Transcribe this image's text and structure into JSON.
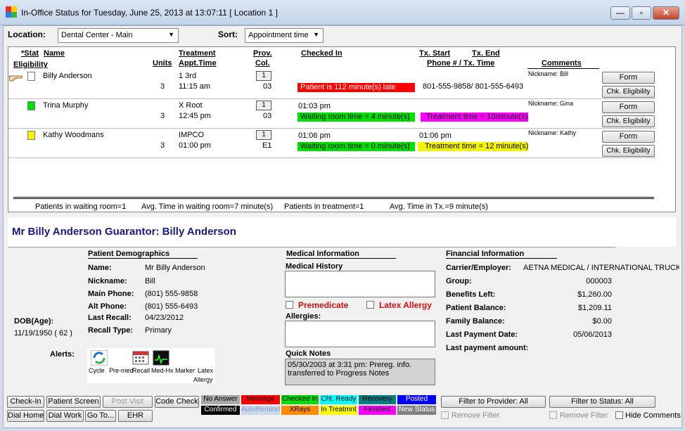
{
  "window": {
    "title": "In-Office Status for Tuesday, June 25, 2013 at 13:07:11 [ Location 1 ]",
    "min": "—",
    "max": "▫",
    "close": "✕"
  },
  "filters": {
    "location_label": "Location:",
    "location_value": "Dental Center - Main",
    "sort_label": "Sort:",
    "sort_value": "Appointment time"
  },
  "columns": {
    "stat": "*Stat",
    "name": "Name",
    "eligibility": "Eligibility",
    "units": "Units",
    "treatment": "Treatment",
    "appt_time": "Appt.Time",
    "prov": "Prov.",
    "col": "Col.",
    "checked_in": "Checked In",
    "tx_start": "Tx. Start",
    "tx_end": "Tx. End",
    "phone_tx_time": "Phone # / Tx. Time",
    "comments": "Comments"
  },
  "patients": [
    {
      "name": "Billy Anderson",
      "units": "3",
      "treatment": "1 3rd",
      "appt_time": "11:15 am",
      "col": "1",
      "prov": "03",
      "checked_in": "",
      "status_msg": "Patient is 112 minute(s) late",
      "tx_start": "",
      "phone": "801-555-9858/ 801-555-6493",
      "treatment_msg": "",
      "comment": "Nickname: Bill",
      "form": "Form",
      "chk": "Chk. Eligibility",
      "status_color": "#ffffff"
    },
    {
      "name": "Trina Murphy",
      "units": "3",
      "treatment": "X Root",
      "appt_time": "12:45 pm",
      "col": "1",
      "prov": "03",
      "checked_in": "01:03 pm",
      "status_msg": "Waiting room time = 4 minute(s)",
      "tx_start": "",
      "phone": "",
      "treatment_msg": "Treatment time = 10minute(s)",
      "comment": "Nickname: Gina",
      "form": "Form",
      "chk": "Chk. Eligibility",
      "status_color": "#00e000"
    },
    {
      "name": "Kathy Woodmans",
      "units": "3",
      "treatment": "IMPCO",
      "appt_time": "01:00 pm",
      "col": "1",
      "prov": "E1",
      "checked_in": "01:06 pm",
      "status_msg": "Waiting room time = 0 minute(s)",
      "tx_start": "01:06 pm",
      "phone": "",
      "treatment_msg": "Treatment time = 12 minute(s)",
      "comment": "Nickname: Kathy",
      "form": "Form",
      "chk": "Chk. Eligibility",
      "status_color": "#f5f500"
    }
  ],
  "summary": {
    "waiting": "Patients in waiting room=1",
    "avg_waiting": "Avg. Time in waiting room=7 minute(s)",
    "in_treatment": "Patients in treatment=1",
    "avg_tx": "Avg. Time in Tx.=9 minute(s)"
  },
  "detail": {
    "header": "Mr Billy Anderson  Guarantor: Billy Anderson",
    "dob_label": "DOB(Age):",
    "dob_value": "11/19/1950 ( 62 )",
    "alerts_label": "Alerts:",
    "alert_icons": [
      "Cycle",
      "Pre-med",
      "Recall",
      "Med-Hx",
      "Marker",
      "Latex",
      "Allergy"
    ],
    "demographics": {
      "title": "Patient Demographics",
      "name_label": "Name:",
      "name": "Mr Billy Anderson",
      "nickname_label": "Nickname:",
      "nickname": "Bill",
      "main_phone_label": "Main Phone:",
      "main_phone": "(801) 555-9858",
      "alt_phone_label": "Alt Phone:",
      "alt_phone": "(801) 555-6493",
      "last_recall_label": "Last Recall:",
      "last_recall": "04/23/2012",
      "recall_type_label": "Recall Type:",
      "recall_type": "Primary"
    },
    "medical": {
      "title": "Medical Information",
      "history_label": "Medical History",
      "premedicate": "Premedicate",
      "latex": "Latex Allergy",
      "allergies_label": "Allergies:",
      "quick_notes_label": "Quick Notes",
      "quick_notes": "05/30/2003 at 3:31 pm: Prereg. info. transferred to Progress Notes"
    },
    "financial": {
      "title": "Financial Information",
      "carrier_label": "Carrier/Employer:",
      "carrier": "AETNA MEDICAL / INTERNATIONAL TRUCK",
      "group_label": "Group:",
      "group": "000003",
      "benefits_label": "Benefits Left:",
      "benefits": "$1,260.00",
      "patient_balance_label": "Patient Balance:",
      "patient_balance": "$1,209.11",
      "family_balance_label": "Family Balance:",
      "family_balance": "$0.00",
      "last_payment_date_label": "Last Payment Date:",
      "last_payment_date": "05/06/2013",
      "last_payment_amount_label": "Last payment amount:",
      "last_payment_amount": ""
    }
  },
  "buttons": {
    "check_in": "Check-In",
    "patient_screen": "Patient Screen",
    "post_visit": "Post Visit",
    "code_check": "Code Check",
    "dial_home": "Dial Home",
    "dial_work": "Dial Work",
    "go_to": "Go To...",
    "ehr": "EHR",
    "filter_provider": "Filter to Provider: All",
    "filter_status": "Filter to Status: All",
    "remove_filter_1": "Remove Filter",
    "remove_filter_2": "Remove Filter",
    "hide_comments": "Hide Comments"
  },
  "legend": [
    {
      "label": "No Answer",
      "bg": "#a8a8a8",
      "fg": "#000000"
    },
    {
      "label": "Message",
      "bg": "#ff0000",
      "fg": "#000000"
    },
    {
      "label": "Checked In",
      "bg": "#00dd00",
      "fg": "#000000"
    },
    {
      "label": "Cht. Ready",
      "bg": "#00ffff",
      "fg": "#000000"
    },
    {
      "label": "Recovery",
      "bg": "#008080",
      "fg": "#000000"
    },
    {
      "label": "Posted",
      "bg": "#0000ff",
      "fg": "#ffffff"
    },
    {
      "label": "Confirmed",
      "bg": "#000000",
      "fg": "#ffffff"
    },
    {
      "label": "AutoRemind",
      "bg": "#c9d8ef",
      "fg": "#8a9ab8"
    },
    {
      "label": "XRays",
      "bg": "#ff8c00",
      "fg": "#000000"
    },
    {
      "label": "In Treatmnt",
      "bg": "#ffff00",
      "fg": "#000000"
    },
    {
      "label": "Finished",
      "bg": "#ff00ff",
      "fg": "#000000"
    },
    {
      "label": "New Status",
      "bg": "#808080",
      "fg": "#ffffff"
    }
  ]
}
